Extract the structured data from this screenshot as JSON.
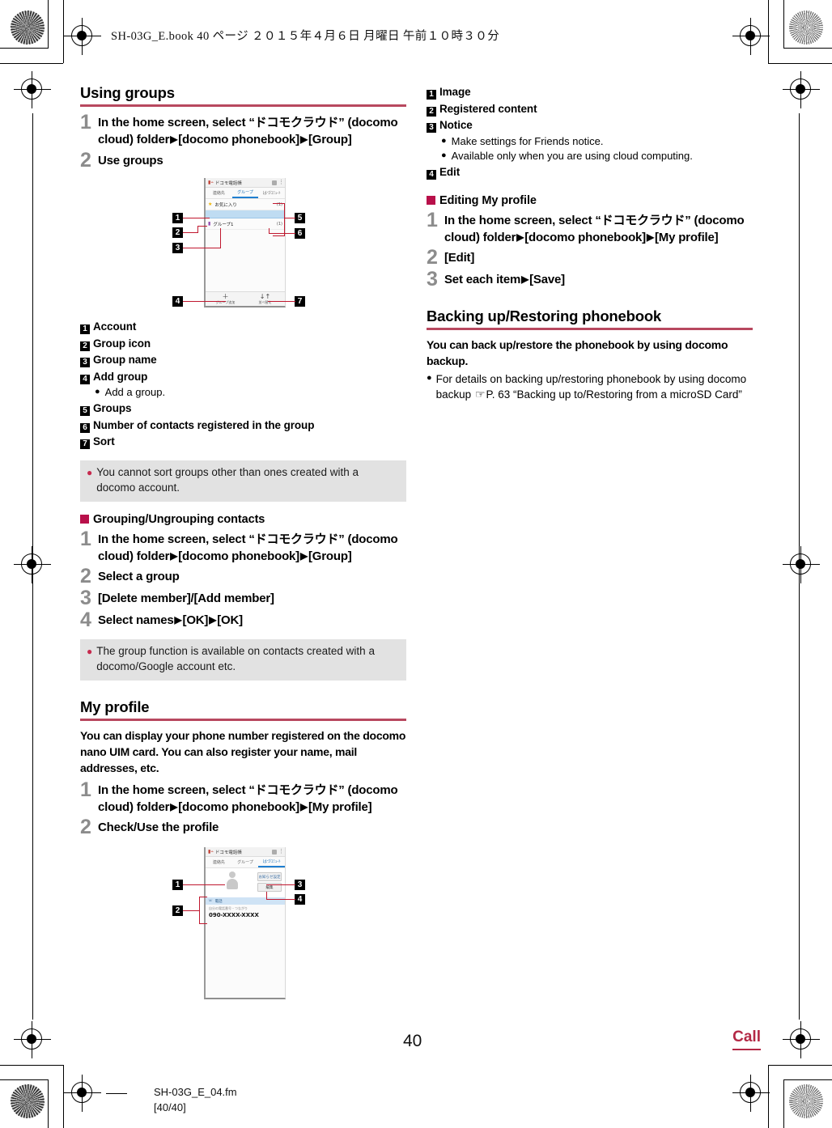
{
  "page": {
    "book_header": "SH-03G_E.book   40 ページ   ２０１５年４月６日   月曜日   午前１０時３０分",
    "page_number": "40",
    "chapter_tab": "Call",
    "file_footer_line1": "SH-03G_E_04.fm",
    "file_footer_line2": "[40/40]",
    "accent_color": "#b8485f",
    "marker_color": "#b8104a",
    "leader_color": "#c0182f"
  },
  "left": {
    "using_groups": {
      "title": "Using groups",
      "steps": [
        {
          "num": "1",
          "parts": [
            {
              "t": "In the home screen, select “"
            },
            {
              "t": "ドコモクラウド",
              "jp": true
            },
            {
              "t": "” (docomo cloud) folder"
            },
            {
              "arrow": "▶"
            },
            {
              "t": "[docomo phonebook]"
            },
            {
              "arrow": "▶"
            },
            {
              "t": "[Group]"
            }
          ]
        },
        {
          "num": "2",
          "parts": [
            {
              "t": "Use groups"
            }
          ]
        }
      ],
      "figure": {
        "phone_title": "ドコモ電話帳",
        "tabs": [
          "連絡先",
          "グループ",
          "はづｺﾐｭ-ﾄ"
        ],
        "active_tab_index": 1,
        "rows": [
          {
            "label": "お気に入り",
            "count": "(1)",
            "icon": "star"
          },
          {
            "label": "",
            "count": "",
            "selected": true
          },
          {
            "label": "グループ1",
            "count": "(1)",
            "icon": "group"
          }
        ],
        "bottom_buttons": [
          {
            "glyph": "＋",
            "label": "グループ追加"
          },
          {
            "glyph": "↓↑",
            "label": "並べ替え"
          }
        ],
        "callouts": [
          "1",
          "2",
          "3",
          "4",
          "5",
          "6",
          "7"
        ]
      },
      "legend": [
        {
          "num": "1",
          "label": "Account"
        },
        {
          "num": "2",
          "label": "Group icon"
        },
        {
          "num": "3",
          "label": "Group name"
        },
        {
          "num": "4",
          "label": "Add group",
          "sub": [
            "Add a group."
          ]
        },
        {
          "num": "5",
          "label": "Groups"
        },
        {
          "num": "6",
          "label": "Number of contacts registered in the group"
        },
        {
          "num": "7",
          "label": "Sort"
        }
      ],
      "note": "You cannot sort groups other than ones created with a docomo account."
    },
    "grouping": {
      "heading": "Grouping/Ungrouping contacts",
      "steps": [
        {
          "num": "1",
          "parts": [
            {
              "t": "In the home screen, select “"
            },
            {
              "t": "ドコモクラウド",
              "jp": true
            },
            {
              "t": "” (docomo cloud) folder"
            },
            {
              "arrow": "▶"
            },
            {
              "t": "[docomo phonebook]"
            },
            {
              "arrow": "▶"
            },
            {
              "t": "[Group]"
            }
          ]
        },
        {
          "num": "2",
          "parts": [
            {
              "t": "Select a group"
            }
          ]
        },
        {
          "num": "3",
          "parts": [
            {
              "t": "[Delete member]/[Add member]"
            }
          ]
        },
        {
          "num": "4",
          "parts": [
            {
              "t": "Select names"
            },
            {
              "arrow": "▶"
            },
            {
              "t": "[OK]"
            },
            {
              "arrow": "▶"
            },
            {
              "t": "[OK]"
            }
          ]
        }
      ],
      "note": "The group function is available on contacts created with a docomo/Google account etc."
    },
    "my_profile": {
      "title": "My profile",
      "intro": "You can display your phone number registered on the docomo nano UIM card. You can also register your name, mail addresses, etc.",
      "steps": [
        {
          "num": "1",
          "parts": [
            {
              "t": "In the home screen, select “"
            },
            {
              "t": "ドコモクラウド",
              "jp": true
            },
            {
              "t": "” (docomo cloud) folder"
            },
            {
              "arrow": "▶"
            },
            {
              "t": "[docomo phonebook]"
            },
            {
              "arrow": "▶"
            },
            {
              "t": "[My profile]"
            }
          ]
        },
        {
          "num": "2",
          "parts": [
            {
              "t": "Check/Use the profile"
            }
          ]
        }
      ],
      "figure": {
        "phone_title": "ドコモ電話帳",
        "tabs": [
          "連絡先",
          "グループ",
          "はづｺﾐｭ-ﾄ"
        ],
        "active_tab_index": 2,
        "notice_button": "お知らせ設定",
        "edit_button": "編集",
        "phone_section_label": "電話",
        "field_label": "自分の電話番号・つながり",
        "phone_value": "090-XXXX-XXXX",
        "callouts": [
          "1",
          "2",
          "3",
          "4"
        ]
      }
    }
  },
  "right": {
    "profile_legend": [
      {
        "num": "1",
        "label": "Image"
      },
      {
        "num": "2",
        "label": "Registered content"
      },
      {
        "num": "3",
        "label": "Notice",
        "sub": [
          "Make settings for Friends notice.",
          "Available only when you are using cloud computing."
        ]
      },
      {
        "num": "4",
        "label": "Edit"
      }
    ],
    "editing_my_profile": {
      "heading": "Editing My profile",
      "steps": [
        {
          "num": "1",
          "parts": [
            {
              "t": "In the home screen, select “"
            },
            {
              "t": "ドコモクラウド",
              "jp": true
            },
            {
              "t": "” (docomo cloud) folder"
            },
            {
              "arrow": "▶"
            },
            {
              "t": "[docomo phonebook]"
            },
            {
              "arrow": "▶"
            },
            {
              "t": "[My profile]"
            }
          ]
        },
        {
          "num": "2",
          "parts": [
            {
              "t": "[Edit]"
            }
          ]
        },
        {
          "num": "3",
          "parts": [
            {
              "t": "Set each item"
            },
            {
              "arrow": "▶"
            },
            {
              "t": "[Save]"
            }
          ]
        }
      ]
    },
    "backup": {
      "title": "Backing up/Restoring phonebook",
      "intro": "You can back up/restore the phonebook by using docomo backup.",
      "bullet_pre": "For details on backing up/restoring phonebook by using docomo backup ",
      "bullet_ref_icon": "☞",
      "bullet_post": "P. 63 “Backing up to/Restoring from a microSD Card”"
    }
  }
}
